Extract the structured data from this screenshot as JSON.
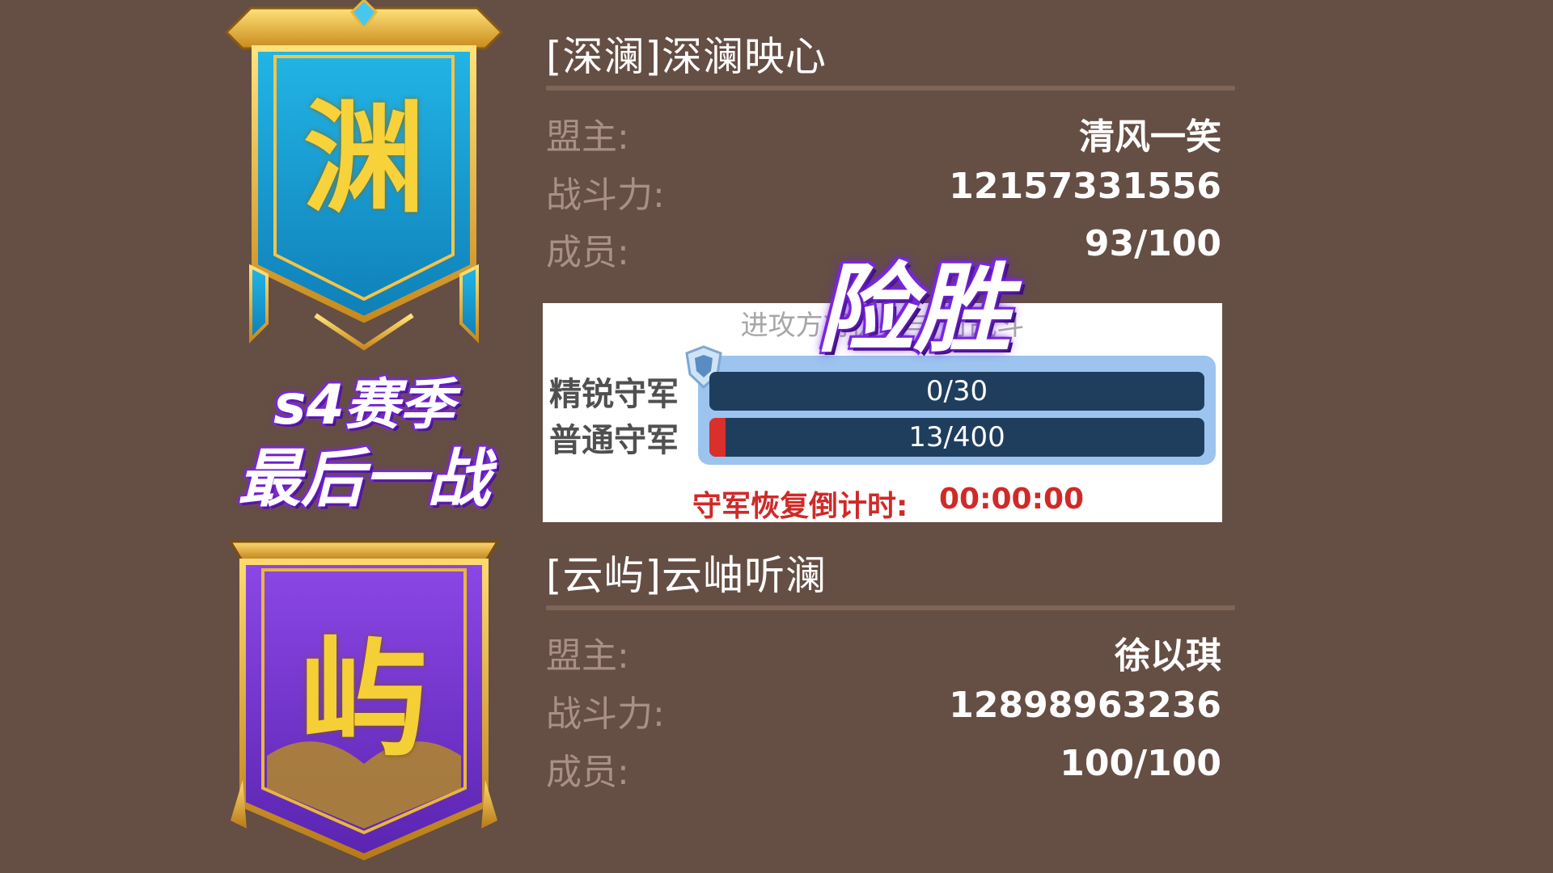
{
  "overlay": {
    "season_line1": "s4赛季",
    "season_line2": "最后一战",
    "result": "险胜"
  },
  "defender": {
    "emblem": "渊",
    "name": "[深澜]深澜映心",
    "leader_label": "盟主:",
    "leader": "清风一笑",
    "power_label": "战斗力:",
    "power": "12157331556",
    "members_label": "成员:",
    "members": "93/100",
    "color": "#1aa3d4"
  },
  "attacker": {
    "emblem": "屿",
    "name": "[云屿]云岫听澜",
    "leader_label": "盟主:",
    "leader": "徐以琪",
    "power_label": "战斗力:",
    "power": "12898963236",
    "members_label": "成员:",
    "members": "100/100",
    "color": "#7a3ad6"
  },
  "battle_panel": {
    "hint": "进攻方将优先与              行战斗",
    "elite_label": "精锐守军",
    "elite_value": "0/30",
    "elite_fraction": 0,
    "normal_label": "普通守军",
    "normal_value": "13/400",
    "normal_fraction": 0.0325,
    "countdown_label": "守军恢复倒计时:",
    "countdown_value": "00:00:00"
  }
}
